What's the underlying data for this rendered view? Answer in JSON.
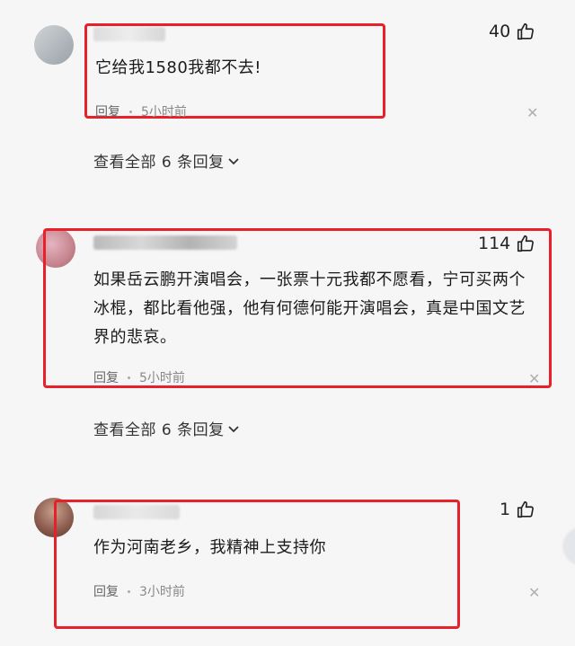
{
  "comments": [
    {
      "likes": "40",
      "text": "它给我1580我都不去!",
      "reply_label": "回复",
      "time": "5小时前",
      "view_all": "查看全部 6 条回复"
    },
    {
      "likes": "114",
      "text": "如果岳云鹏开演唱会，一张票十元我都不愿看，宁可买两个冰棍，都比看他强，他有何德何能开演唱会，真是中国文艺界的悲哀。",
      "reply_label": "回复",
      "time": "5小时前",
      "view_all": "查看全部 6 条回复"
    },
    {
      "likes": "1",
      "text": "作为河南老乡，我精神上支持你",
      "reply_label": "回复",
      "time": "3小时前"
    }
  ],
  "colors": {
    "highlight_box": "#e8202a",
    "background": "#f6f6f7"
  },
  "icons": {
    "like": "thumbs-up-icon",
    "close": "close-icon",
    "expand": "chevron-down-icon"
  }
}
